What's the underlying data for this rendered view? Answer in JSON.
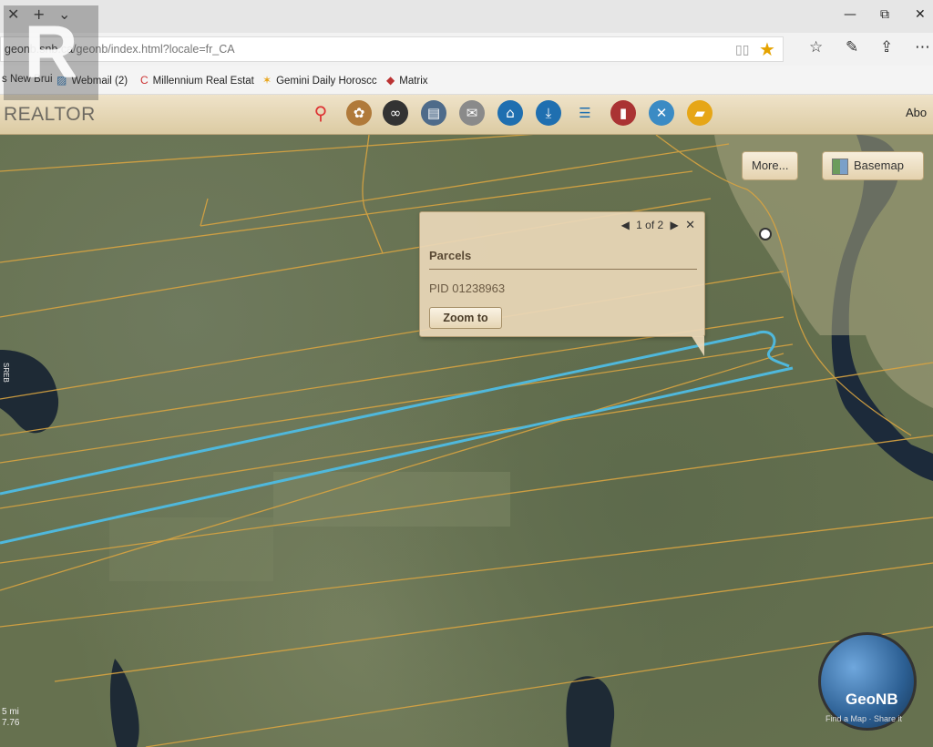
{
  "browser": {
    "url_host": "geonb.snb.ca",
    "url_path": "/geonb/index.html?locale=fr_CA",
    "favorites": [
      {
        "label": "s New Brui",
        "icon": "page-icon"
      },
      {
        "label": "Webmail (2)",
        "icon": "mail-icon"
      },
      {
        "label": "Millennium Real Estat",
        "icon": "cs-logo-icon"
      },
      {
        "label": "Gemini Daily Horoscc",
        "icon": "star-burst-icon"
      },
      {
        "label": "Matrix",
        "icon": "cube-icon"
      }
    ],
    "tab_controls": {
      "close": "✕",
      "new": "+",
      "dropdown": "⌄"
    },
    "window_controls": {
      "minimize": "—",
      "restore": "⧉",
      "close": "✕"
    }
  },
  "watermark": {
    "word": "REALTOR",
    "mark": "R"
  },
  "toolbar": {
    "about_label": "Abo",
    "icons": [
      "pin-icon",
      "paint-palette-icon",
      "binoculars-icon",
      "printer-icon",
      "mailbox-icon",
      "home-icon",
      "download-icon",
      "list-icon",
      "book-icon",
      "globe-tool-icon",
      "folder-icon"
    ]
  },
  "map": {
    "more_label": "More...",
    "basemap_label": "Basemap",
    "scale_text": "5 mi",
    "scale_coord": "7.76",
    "side_text": "SREB",
    "popup": {
      "pager": "1 of 2",
      "title": "Parcels",
      "pid": "PID 01238963",
      "zoom_label": "Zoom to"
    },
    "globe": {
      "label": "GeoNB",
      "sub": "Find a Map · Share it"
    }
  },
  "colors": {
    "parcel_line": "#d9a441",
    "selected_parcel": "#4fb8dc",
    "toolbar_bg": "#e6d6b2",
    "popup_bg": "#e9d7b8"
  }
}
